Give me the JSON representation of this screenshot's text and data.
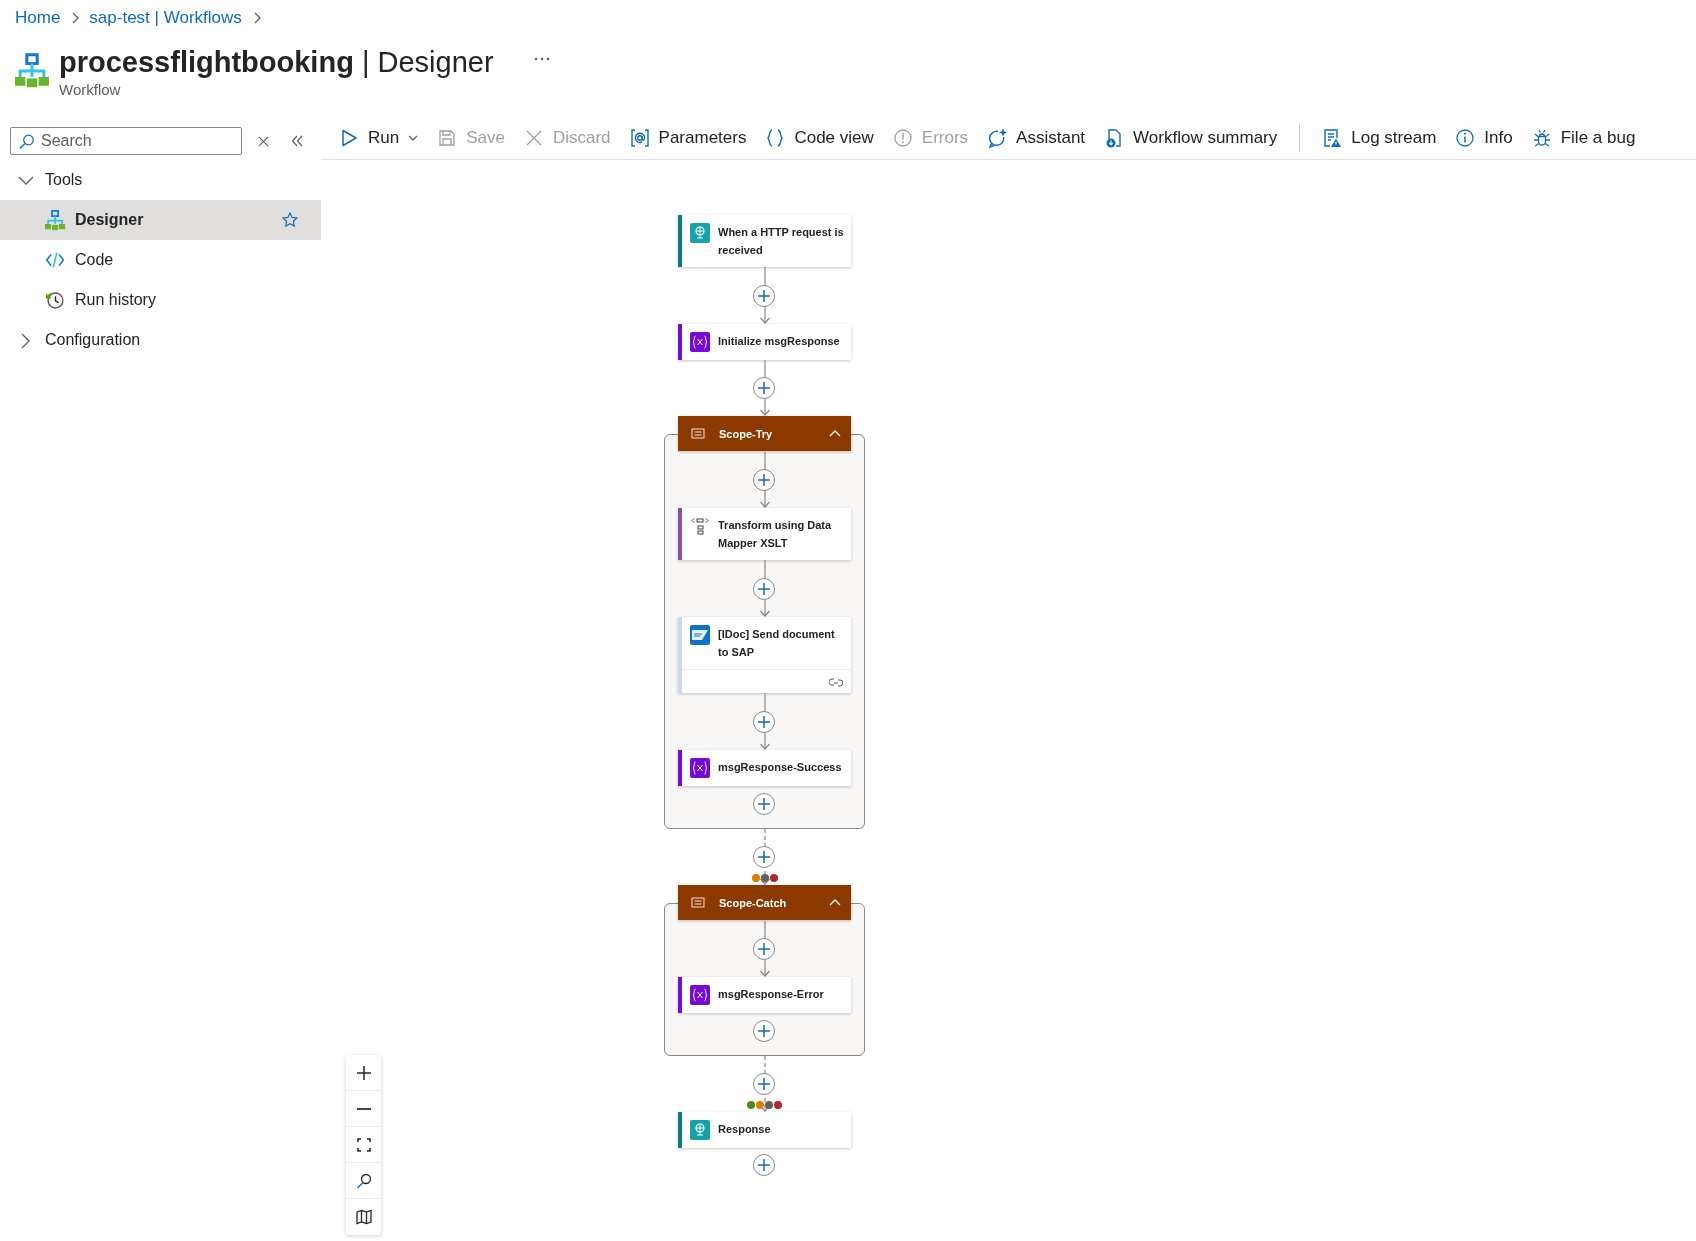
{
  "breadcrumb": [
    {
      "label": "Home"
    },
    {
      "label": "sap-test | Workflows"
    }
  ],
  "page": {
    "title": "**processflightbooking** | Designer",
    "subtitle": "Workflow"
  },
  "sidebar": {
    "search": {
      "placeholder": "Search"
    },
    "tree": [
      {
        "label": "Tools",
        "expanded": true,
        "children": [
          {
            "label": "Designer",
            "selected": true
          },
          {
            "label": "Code",
            "selected": false
          },
          {
            "label": "Run history",
            "selected": false
          }
        ]
      },
      {
        "label": "Configuration",
        "expanded": false
      }
    ]
  },
  "toolbar": {
    "groups": [
      [
        {
          "label": "Run",
          "disabled": false,
          "dropdown": true
        },
        {
          "label": "Save",
          "disabled": true
        },
        {
          "label": "Discard",
          "disabled": true
        },
        {
          "label": "Parameters",
          "disabled": false
        },
        {
          "label": "Code view",
          "disabled": false
        },
        {
          "label": "Errors",
          "disabled": true
        },
        {
          "label": "Assistant",
          "disabled": false
        },
        {
          "label": "Workflow summary",
          "disabled": false
        }
      ],
      [
        {
          "label": "Log stream",
          "disabled": false
        },
        {
          "label": "Info",
          "disabled": false
        },
        {
          "label": "File a bug",
          "disabled": false
        }
      ]
    ]
  },
  "workflow": {
    "steps": [
      {
        "kind": "http",
        "color": "#0e7a82",
        "title": "When a HTTP request is received"
      },
      {
        "kind": "variable",
        "color": "#770bd6",
        "title": "Initialize msgResponse"
      },
      {
        "kind": "scope",
        "title": "Scope-Try",
        "expanded": true,
        "steps": [
          {
            "kind": "mapper",
            "color": "#8c4fa8",
            "title": "Transform using Data Mapper XSLT"
          },
          {
            "kind": "sap",
            "color": "#c7d8f5",
            "title": "[IDoc] Send document to SAP",
            "connection": true
          },
          {
            "kind": "variable",
            "color": "#770bd6",
            "title": "msgResponse-Success"
          }
        ]
      },
      {
        "kind": "scope",
        "title": "Scope-Catch",
        "expanded": true,
        "run_after": [
          {
            "color": "#e07b00"
          },
          {
            "color": "#616161"
          },
          {
            "color": "#b4262a"
          }
        ],
        "steps": [
          {
            "kind": "variable",
            "color": "#770bd6",
            "title": "msgResponse-Error"
          }
        ]
      },
      {
        "kind": "http",
        "color": "#0e7a82",
        "title": "Response",
        "run_after": [
          {
            "color": "#4f8a10"
          },
          {
            "color": "#e07b00"
          },
          {
            "color": "#616161"
          },
          {
            "color": "#b4262a"
          }
        ]
      }
    ]
  }
}
